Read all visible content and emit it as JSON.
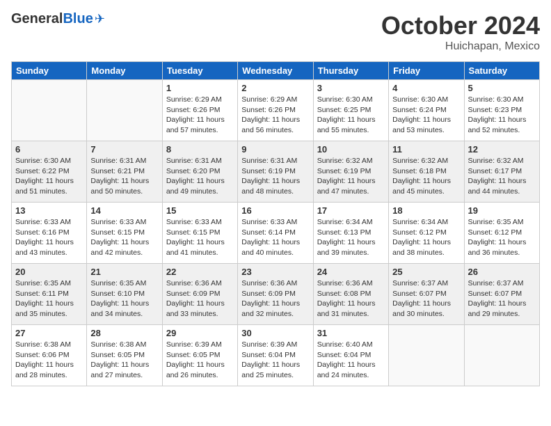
{
  "header": {
    "logo_general": "General",
    "logo_blue": "Blue",
    "month_title": "October 2024",
    "location": "Huichapan, Mexico"
  },
  "weekdays": [
    "Sunday",
    "Monday",
    "Tuesday",
    "Wednesday",
    "Thursday",
    "Friday",
    "Saturday"
  ],
  "weeks": [
    [
      {
        "day": "",
        "info": ""
      },
      {
        "day": "",
        "info": ""
      },
      {
        "day": "1",
        "info": "Sunrise: 6:29 AM\nSunset: 6:26 PM\nDaylight: 11 hours and 57 minutes."
      },
      {
        "day": "2",
        "info": "Sunrise: 6:29 AM\nSunset: 6:26 PM\nDaylight: 11 hours and 56 minutes."
      },
      {
        "day": "3",
        "info": "Sunrise: 6:30 AM\nSunset: 6:25 PM\nDaylight: 11 hours and 55 minutes."
      },
      {
        "day": "4",
        "info": "Sunrise: 6:30 AM\nSunset: 6:24 PM\nDaylight: 11 hours and 53 minutes."
      },
      {
        "day": "5",
        "info": "Sunrise: 6:30 AM\nSunset: 6:23 PM\nDaylight: 11 hours and 52 minutes."
      }
    ],
    [
      {
        "day": "6",
        "info": "Sunrise: 6:30 AM\nSunset: 6:22 PM\nDaylight: 11 hours and 51 minutes."
      },
      {
        "day": "7",
        "info": "Sunrise: 6:31 AM\nSunset: 6:21 PM\nDaylight: 11 hours and 50 minutes."
      },
      {
        "day": "8",
        "info": "Sunrise: 6:31 AM\nSunset: 6:20 PM\nDaylight: 11 hours and 49 minutes."
      },
      {
        "day": "9",
        "info": "Sunrise: 6:31 AM\nSunset: 6:19 PM\nDaylight: 11 hours and 48 minutes."
      },
      {
        "day": "10",
        "info": "Sunrise: 6:32 AM\nSunset: 6:19 PM\nDaylight: 11 hours and 47 minutes."
      },
      {
        "day": "11",
        "info": "Sunrise: 6:32 AM\nSunset: 6:18 PM\nDaylight: 11 hours and 45 minutes."
      },
      {
        "day": "12",
        "info": "Sunrise: 6:32 AM\nSunset: 6:17 PM\nDaylight: 11 hours and 44 minutes."
      }
    ],
    [
      {
        "day": "13",
        "info": "Sunrise: 6:33 AM\nSunset: 6:16 PM\nDaylight: 11 hours and 43 minutes."
      },
      {
        "day": "14",
        "info": "Sunrise: 6:33 AM\nSunset: 6:15 PM\nDaylight: 11 hours and 42 minutes."
      },
      {
        "day": "15",
        "info": "Sunrise: 6:33 AM\nSunset: 6:15 PM\nDaylight: 11 hours and 41 minutes."
      },
      {
        "day": "16",
        "info": "Sunrise: 6:33 AM\nSunset: 6:14 PM\nDaylight: 11 hours and 40 minutes."
      },
      {
        "day": "17",
        "info": "Sunrise: 6:34 AM\nSunset: 6:13 PM\nDaylight: 11 hours and 39 minutes."
      },
      {
        "day": "18",
        "info": "Sunrise: 6:34 AM\nSunset: 6:12 PM\nDaylight: 11 hours and 38 minutes."
      },
      {
        "day": "19",
        "info": "Sunrise: 6:35 AM\nSunset: 6:12 PM\nDaylight: 11 hours and 36 minutes."
      }
    ],
    [
      {
        "day": "20",
        "info": "Sunrise: 6:35 AM\nSunset: 6:11 PM\nDaylight: 11 hours and 35 minutes."
      },
      {
        "day": "21",
        "info": "Sunrise: 6:35 AM\nSunset: 6:10 PM\nDaylight: 11 hours and 34 minutes."
      },
      {
        "day": "22",
        "info": "Sunrise: 6:36 AM\nSunset: 6:09 PM\nDaylight: 11 hours and 33 minutes."
      },
      {
        "day": "23",
        "info": "Sunrise: 6:36 AM\nSunset: 6:09 PM\nDaylight: 11 hours and 32 minutes."
      },
      {
        "day": "24",
        "info": "Sunrise: 6:36 AM\nSunset: 6:08 PM\nDaylight: 11 hours and 31 minutes."
      },
      {
        "day": "25",
        "info": "Sunrise: 6:37 AM\nSunset: 6:07 PM\nDaylight: 11 hours and 30 minutes."
      },
      {
        "day": "26",
        "info": "Sunrise: 6:37 AM\nSunset: 6:07 PM\nDaylight: 11 hours and 29 minutes."
      }
    ],
    [
      {
        "day": "27",
        "info": "Sunrise: 6:38 AM\nSunset: 6:06 PM\nDaylight: 11 hours and 28 minutes."
      },
      {
        "day": "28",
        "info": "Sunrise: 6:38 AM\nSunset: 6:05 PM\nDaylight: 11 hours and 27 minutes."
      },
      {
        "day": "29",
        "info": "Sunrise: 6:39 AM\nSunset: 6:05 PM\nDaylight: 11 hours and 26 minutes."
      },
      {
        "day": "30",
        "info": "Sunrise: 6:39 AM\nSunset: 6:04 PM\nDaylight: 11 hours and 25 minutes."
      },
      {
        "day": "31",
        "info": "Sunrise: 6:40 AM\nSunset: 6:04 PM\nDaylight: 11 hours and 24 minutes."
      },
      {
        "day": "",
        "info": ""
      },
      {
        "day": "",
        "info": ""
      }
    ]
  ]
}
